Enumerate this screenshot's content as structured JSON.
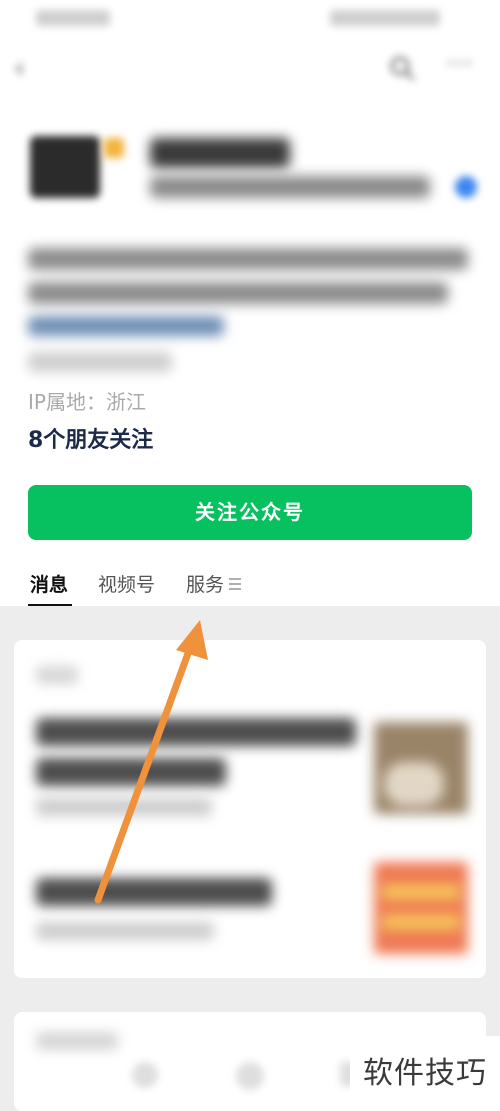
{
  "profile": {
    "ip_location": "IP属地：浙江",
    "friends_following": "8个朋友关注"
  },
  "actions": {
    "follow_label": "关注公众号"
  },
  "tabs": [
    {
      "label": "消息",
      "active": true
    },
    {
      "label": "视频号",
      "active": false
    },
    {
      "label": "服务",
      "active": false
    }
  ],
  "icons": {
    "back": "back-arrow-icon",
    "search": "search-icon",
    "more": "more-icon",
    "tab_menu": "menu-icon"
  },
  "annotation": {
    "color": "#f0913c"
  },
  "colors": {
    "follow_button": "#07c160",
    "friends_text": "#1c2a4a"
  },
  "watermark": {
    "text": "软件技巧"
  }
}
